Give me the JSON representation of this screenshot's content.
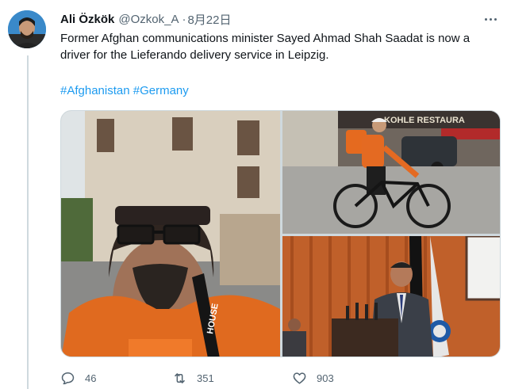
{
  "author": {
    "name": "Ali Özkök",
    "handle": "@Ozkok_A",
    "separator": "·",
    "date": "8月22日"
  },
  "tweet": {
    "text": "Former Afghan communications minister Sayed Ahmad Shah Saadat is now a driver for the Lieferando delivery service in Leipzig.",
    "hashtags": [
      "#Afghanistan",
      "#Germany"
    ]
  },
  "media": {
    "photo2_sign": "KOHLE RESTAURA",
    "photo1_lanyard": "HOUSE"
  },
  "actions": {
    "replies": "46",
    "retweets": "351",
    "likes": "903"
  },
  "icons": {
    "reply": "reply-icon",
    "retweet": "retweet-icon",
    "like": "heart-icon",
    "more": "more-options-icon"
  },
  "colors": {
    "link": "#1d9bf0",
    "secondary_text": "#536471",
    "primary_text": "#0f1419",
    "border": "#cfd9de"
  }
}
